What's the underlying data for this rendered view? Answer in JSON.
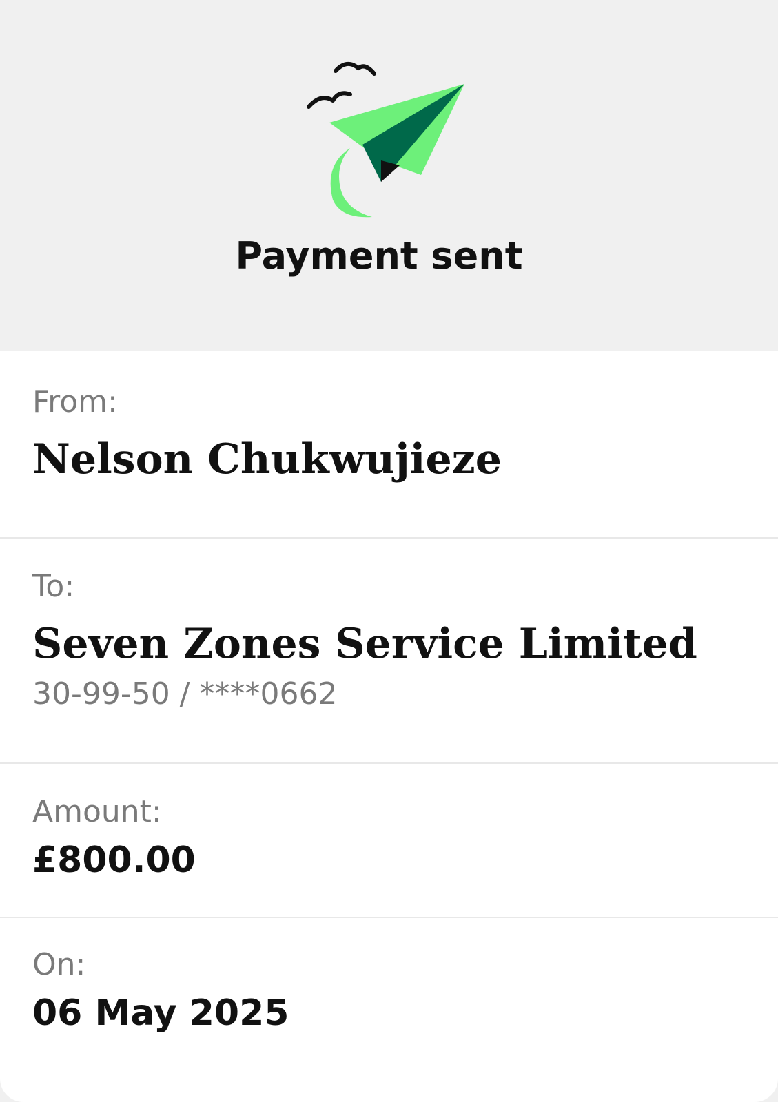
{
  "header": {
    "title": "Payment sent",
    "icon": "paper-plane-icon",
    "colors": {
      "plane_light": "#6df07a",
      "plane_dark": "#00694a"
    }
  },
  "details": {
    "from": {
      "label": "From:",
      "name": "Nelson Chukwujieze"
    },
    "to": {
      "label": "To:",
      "name": "Seven Zones Service Limited",
      "account": "30-99-50 / ****0662"
    },
    "amount": {
      "label": "Amount:",
      "value": "£800.00"
    },
    "date": {
      "label": "On:",
      "value": "06 May 2025"
    }
  }
}
